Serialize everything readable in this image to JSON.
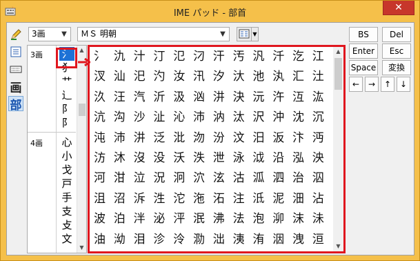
{
  "window": {
    "title": "IME パッド - 部首",
    "close_label": "✕"
  },
  "left_toolbar": {
    "stroke_count_label": "画",
    "radical_label": "部"
  },
  "stroke_select": {
    "value": "3画"
  },
  "font_select": {
    "value": "ＭＳ 明朝"
  },
  "radical_groups": [
    {
      "stroke_label": "3画",
      "radicals": [
        "氵",
        "犭",
        "艹",
        "辶",
        "阝",
        "阝"
      ]
    },
    {
      "stroke_label": "4画",
      "radicals": [
        "心",
        "小",
        "戈",
        "戸",
        "手",
        "支",
        "攴",
        "文"
      ]
    }
  ],
  "selected_radical": "氵",
  "characters": [
    [
      "氵",
      "氿",
      "汁",
      "汀",
      "氾",
      "汈",
      "汗",
      "汚",
      "汎",
      "汘",
      "汔",
      "江"
    ],
    [
      "汊",
      "汕",
      "汜",
      "汋",
      "汝",
      "汛",
      "汐",
      "汏",
      "池",
      "汍",
      "汇",
      "汢"
    ],
    [
      "汣",
      "汪",
      "汽",
      "沂",
      "汲",
      "汹",
      "汫",
      "決",
      "沅",
      "汻",
      "沍",
      "汯"
    ],
    [
      "沆",
      "沟",
      "沙",
      "沚",
      "沁",
      "沛",
      "汭",
      "汰",
      "沢",
      "沖",
      "沈",
      "沉"
    ],
    [
      "沌",
      "沛",
      "汫",
      "泛",
      "沘",
      "沕",
      "汾",
      "汶",
      "汨",
      "汳",
      "汴",
      "沔"
    ],
    [
      "汸",
      "沐",
      "沒",
      "没",
      "沃",
      "泆",
      "泄",
      "泳",
      "泧",
      "沿",
      "泓",
      "泱"
    ],
    [
      "河",
      "泔",
      "泣",
      "況",
      "泂",
      "泬",
      "泫",
      "沽",
      "泒",
      "泗",
      "治",
      "泅"
    ],
    [
      "沮",
      "沼",
      "泝",
      "泩",
      "沱",
      "沲",
      "沰",
      "注",
      "泜",
      "泥",
      "沺",
      "沾"
    ],
    [
      "波",
      "泊",
      "泮",
      "泌",
      "泙",
      "泯",
      "沸",
      "法",
      "泡",
      "泖",
      "沫",
      "沬"
    ],
    [
      "油",
      "泑",
      "泪",
      "沴",
      "泠",
      "泐",
      "泏",
      "洟",
      "洧",
      "洇",
      "洩",
      "洹"
    ]
  ],
  "keypad": {
    "bs": "BS",
    "del": "Del",
    "enter": "Enter",
    "esc": "Esc",
    "space": "Space",
    "convert": "変換",
    "left": "←",
    "right": "→",
    "up": "↑",
    "down": "↓"
  },
  "colors": {
    "titlebar": "#f5c04a",
    "highlight": "#e0161e",
    "selection": "#1e72d6",
    "close": "#c7362b"
  }
}
